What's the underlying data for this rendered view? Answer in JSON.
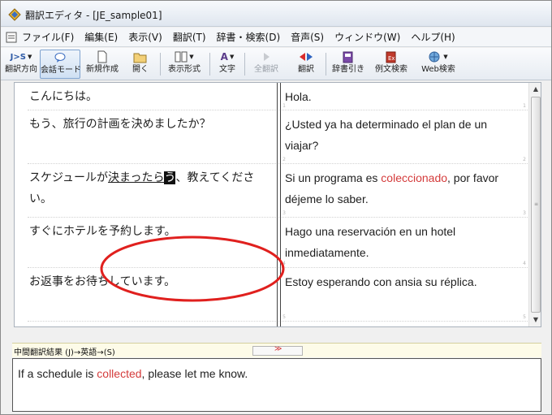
{
  "window": {
    "title": "翻訳エディタ - [JE_sample01]"
  },
  "menu": [
    "ファイル(F)",
    "編集(E)",
    "表示(V)",
    "翻訳(T)",
    "辞書・検索(D)",
    "音声(S)",
    "ウィンドウ(W)",
    "ヘルプ(H)"
  ],
  "toolbar": {
    "direction_icon_text": "J>S",
    "direction": "翻訳方向",
    "conversation_mode": "会話モード",
    "new": "新規作成",
    "open": "開く",
    "display_format": "表示形式",
    "text": "文字",
    "translate_all": "全翻訳",
    "translate": "翻訳",
    "dictionary": "辞書引き",
    "example_search": "例文検索",
    "web_search": "Web検索"
  },
  "rows": [
    {
      "source": "こんにちは。",
      "target": "Hola.",
      "num": "1"
    },
    {
      "source": "もう、旅行の計画を決めましたか？",
      "target": "¿Usted ya ha determinado el plan de un viajar?",
      "num": "2"
    },
    {
      "source_parts": [
        "スケジュールが",
        "決まったら",
        "う",
        "、教えてください。"
      ],
      "target_parts": [
        "Si un programa es ",
        "coleccionado",
        ", por favor déjeme lo saber."
      ],
      "num": "3"
    },
    {
      "source": "すぐにホテルを予約します。",
      "target": "Hago una reservación en un hotel inmediatamente.",
      "num": "4"
    },
    {
      "source": "お返事をお待ちしています。",
      "target": "Estoy esperando con ansia su réplica.",
      "num": "5"
    }
  ],
  "intermediate": {
    "title": "中間翻訳結果 (J)→英語→(S)",
    "text_parts": [
      "If a schedule is ",
      "collected",
      ", please let me know."
    ]
  },
  "colors": {
    "highlight": "#d43b3b",
    "annotation": "#e0201e"
  },
  "icons": [
    "app-icon",
    "document-icon",
    "direction-icon",
    "conversation-icon",
    "new-doc-icon",
    "open-folder-icon",
    "display-format-icon",
    "font-icon",
    "translate-all-icon",
    "translate-icon",
    "dictionary-icon",
    "example-search-icon",
    "web-search-icon"
  ]
}
